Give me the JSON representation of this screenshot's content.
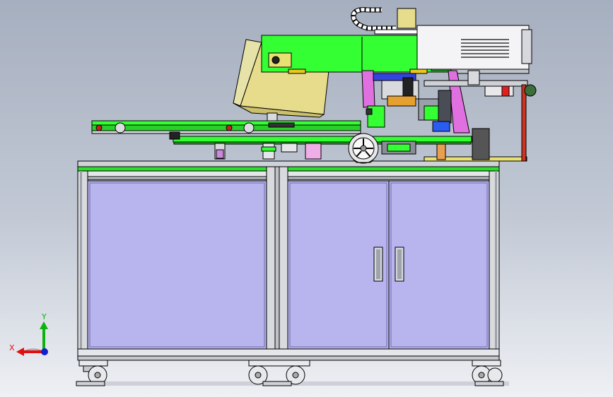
{
  "triad": {
    "x_label": "X",
    "y_label": "Y",
    "x_color": "#e01010",
    "y_color": "#10b010",
    "z_color": "#1020d0"
  },
  "colors": {
    "background_top": "#a6afbf",
    "background_bottom": "#eef0f4",
    "cabinet_panel": "#b7b4ee",
    "frame_rail": "#d8dade",
    "machine_green": "#33ff33",
    "hopper_yellow": "#e6dc8c",
    "magenta_plate": "#e070e0",
    "wire_white": "#ffffff"
  }
}
